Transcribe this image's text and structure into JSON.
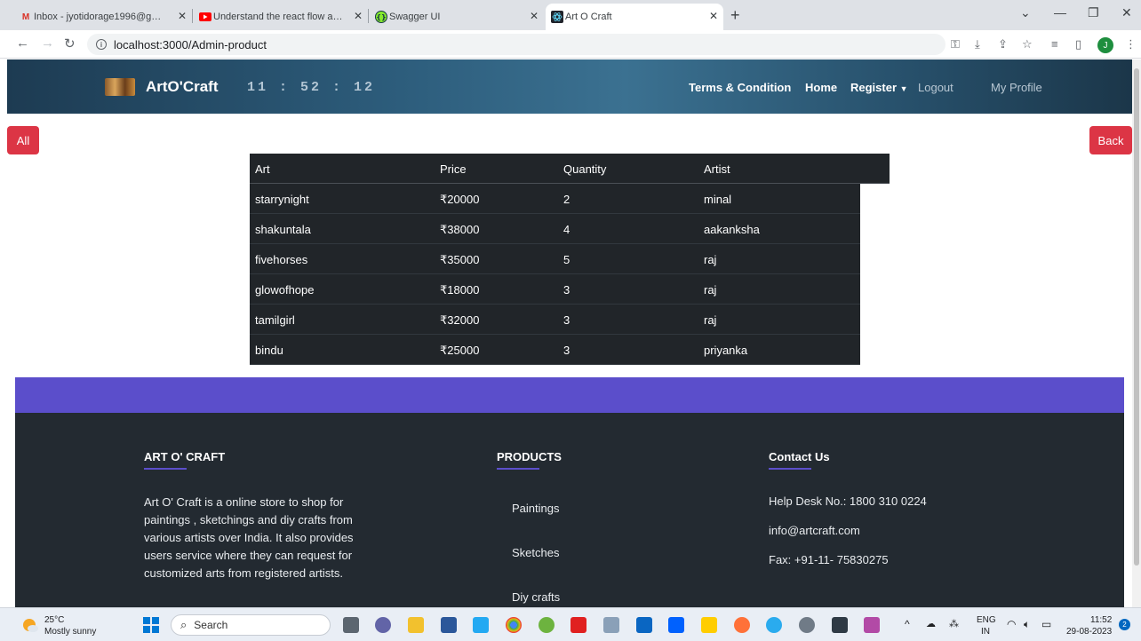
{
  "browser": {
    "tabs": [
      {
        "title": "Inbox - jyotidorage1996@gmail.c",
        "icon": "gmail-icon",
        "color": "#d93025"
      },
      {
        "title": "Understand the react flow and st",
        "icon": "youtube-icon",
        "color": "#ff0000"
      },
      {
        "title": "Swagger UI",
        "icon": "swagger-icon",
        "color": "#85ea2d"
      },
      {
        "title": "Art O Craft",
        "icon": "react-icon",
        "color": "#20232a"
      }
    ],
    "url": "localhost:3000/Admin-product",
    "profile_initial": "J"
  },
  "header": {
    "brand": "ArtO'Craft",
    "clock": "11 : 52 : 12",
    "nav": {
      "terms": "Terms & Condition",
      "home": "Home",
      "register": "Register",
      "logout": "Logout",
      "profile": "My Profile"
    }
  },
  "buttons": {
    "all": "All",
    "back": "Back"
  },
  "table": {
    "headers": [
      "Art",
      "Price",
      "Quantity",
      "Artist"
    ],
    "rows": [
      [
        "starrynight",
        "₹20000",
        "2",
        "minal"
      ],
      [
        "shakuntala",
        "₹38000",
        "4",
        "aakanksha"
      ],
      [
        "fivehorses",
        "₹35000",
        "5",
        "raj"
      ],
      [
        "glowofhope",
        "₹18000",
        "3",
        "raj"
      ],
      [
        "tamilgirl",
        "₹32000",
        "3",
        "raj"
      ],
      [
        "bindu",
        "₹25000",
        "3",
        "priyanka"
      ]
    ]
  },
  "footer": {
    "about_title": "ART O' CRAFT",
    "about_lines": [
      "Art O' Craft is a online store to shop for",
      "paintings , sketchings and diy crafts from",
      "various artists over India. It also provides",
      "users service where they can request for",
      "customized arts from registered artists."
    ],
    "products_title": "PRODUCTS",
    "products": [
      "Paintings",
      "Sketches",
      "Diy crafts"
    ],
    "contact_title": "Contact Us",
    "contact": [
      "Help Desk No.: 1800 310 0224",
      "info@artcraft.com",
      "Fax: +91-11- 75830275"
    ]
  },
  "taskbar": {
    "weather_temp": "25°C",
    "weather_desc": "Mostly sunny",
    "search": "Search",
    "lang": "ENG",
    "region": "IN",
    "time": "11:52",
    "date": "29-08-2023",
    "notif_count": "2"
  },
  "colors": {
    "accent_red": "#dc3545",
    "purple": "#5b4ecb",
    "dark": "#212529"
  }
}
